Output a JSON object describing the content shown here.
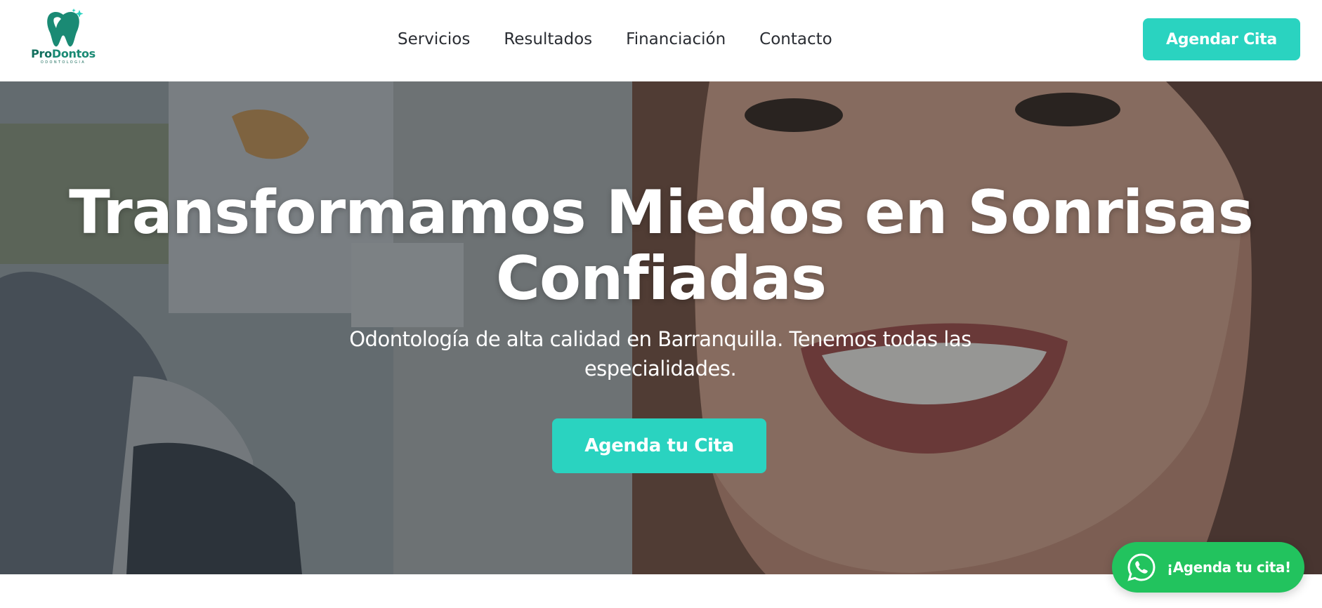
{
  "brand": {
    "name_part1": "Pro",
    "name_part2": "Dontos",
    "tagline": "ODONTOLOGIA",
    "accent_color": "#2ad3c0",
    "brand_green": "#1a8a74"
  },
  "nav": {
    "items": [
      "Servicios",
      "Resultados",
      "Financiación",
      "Contacto"
    ]
  },
  "header": {
    "cta_label": "Agendar Cita"
  },
  "hero": {
    "title": "Transformamos Miedos en Sonrisas Confiadas",
    "subtitle": "Odontología de alta calidad en Barranquilla. Tenemos todas las especialidades.",
    "cta_label": "Agenda tu Cita"
  },
  "whatsapp": {
    "label": "¡Agenda tu cita!",
    "color": "#22c35e",
    "icon": "whatsapp-icon"
  }
}
